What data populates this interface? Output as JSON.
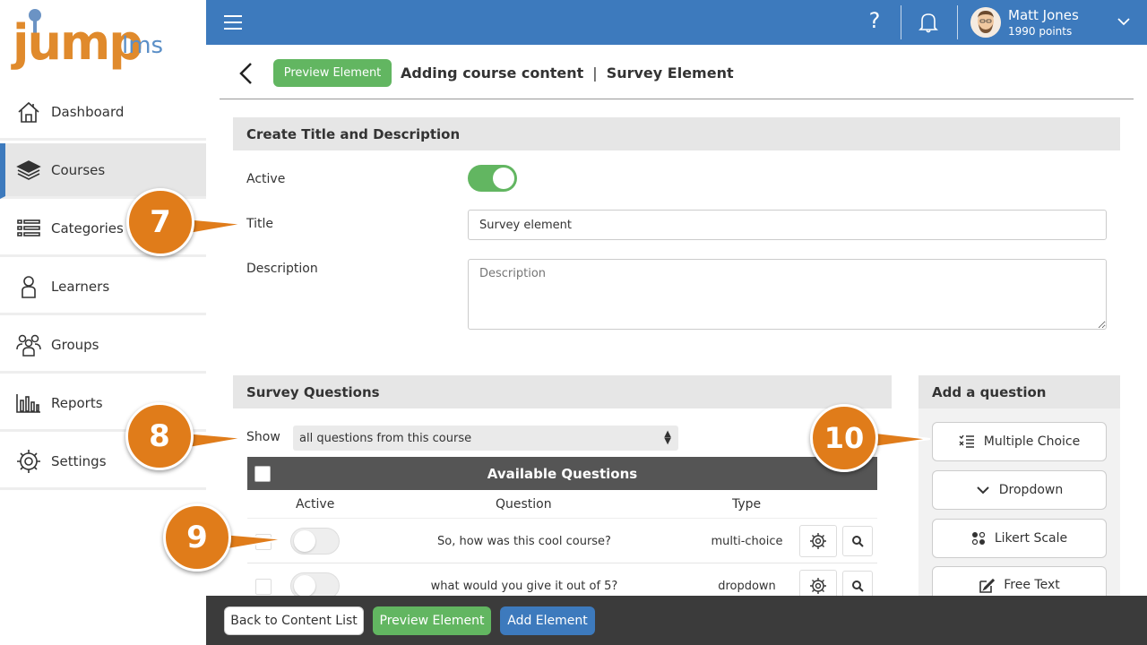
{
  "brand": {
    "logo_main": "jump",
    "logo_sub": "lms"
  },
  "sidebar": {
    "items": [
      {
        "label": "Dashboard",
        "icon": "home-icon"
      },
      {
        "label": "Courses",
        "icon": "books-icon",
        "active": true
      },
      {
        "label": "Categories",
        "icon": "list-icon"
      },
      {
        "label": "Learners",
        "icon": "person-icon"
      },
      {
        "label": "Groups",
        "icon": "group-icon"
      },
      {
        "label": "Reports",
        "icon": "bar-chart-icon"
      },
      {
        "label": "Settings",
        "icon": "gear-icon"
      }
    ]
  },
  "topbar": {
    "help": "?",
    "user_name": "Matt Jones",
    "user_points": "1990 points"
  },
  "header": {
    "preview_label": "Preview Element",
    "crumb_primary": "Adding course content",
    "crumb_separator": "|",
    "crumb_secondary": "Survey Element"
  },
  "details": {
    "heading": "Create Title and Description",
    "active_label": "Active",
    "active_on": true,
    "title_label": "Title",
    "title_value": "Survey element",
    "description_label": "Description",
    "description_placeholder": "Description"
  },
  "survey": {
    "heading": "Survey Questions",
    "show_label": "Show",
    "show_value": "all questions from this course",
    "table_title": "Available Questions",
    "columns": {
      "active": "Active",
      "question": "Question",
      "type": "Type"
    },
    "rows": [
      {
        "question": "So, how was this cool course?",
        "type": "multi-choice",
        "active": false
      },
      {
        "question": "what would you give it out of 5?",
        "type": "dropdown",
        "active": false
      }
    ]
  },
  "add_question": {
    "heading": "Add a question",
    "buttons": [
      {
        "label": "Multiple Choice",
        "icon": "multiple-choice-icon"
      },
      {
        "label": "Dropdown",
        "icon": "chevron-down-icon"
      },
      {
        "label": "Likert Scale",
        "icon": "likert-scale-icon"
      },
      {
        "label": "Free Text",
        "icon": "edit-icon"
      }
    ]
  },
  "callouts": [
    "7",
    "8",
    "9",
    "10"
  ],
  "footer": {
    "back_label": "Back to Content List",
    "preview_label": "Preview Element",
    "add_label": "Add Element"
  },
  "colors": {
    "primary": "#3d7abd",
    "success": "#62b661",
    "accent": "#e07c1a",
    "brand_orange": "#e08a2c"
  }
}
